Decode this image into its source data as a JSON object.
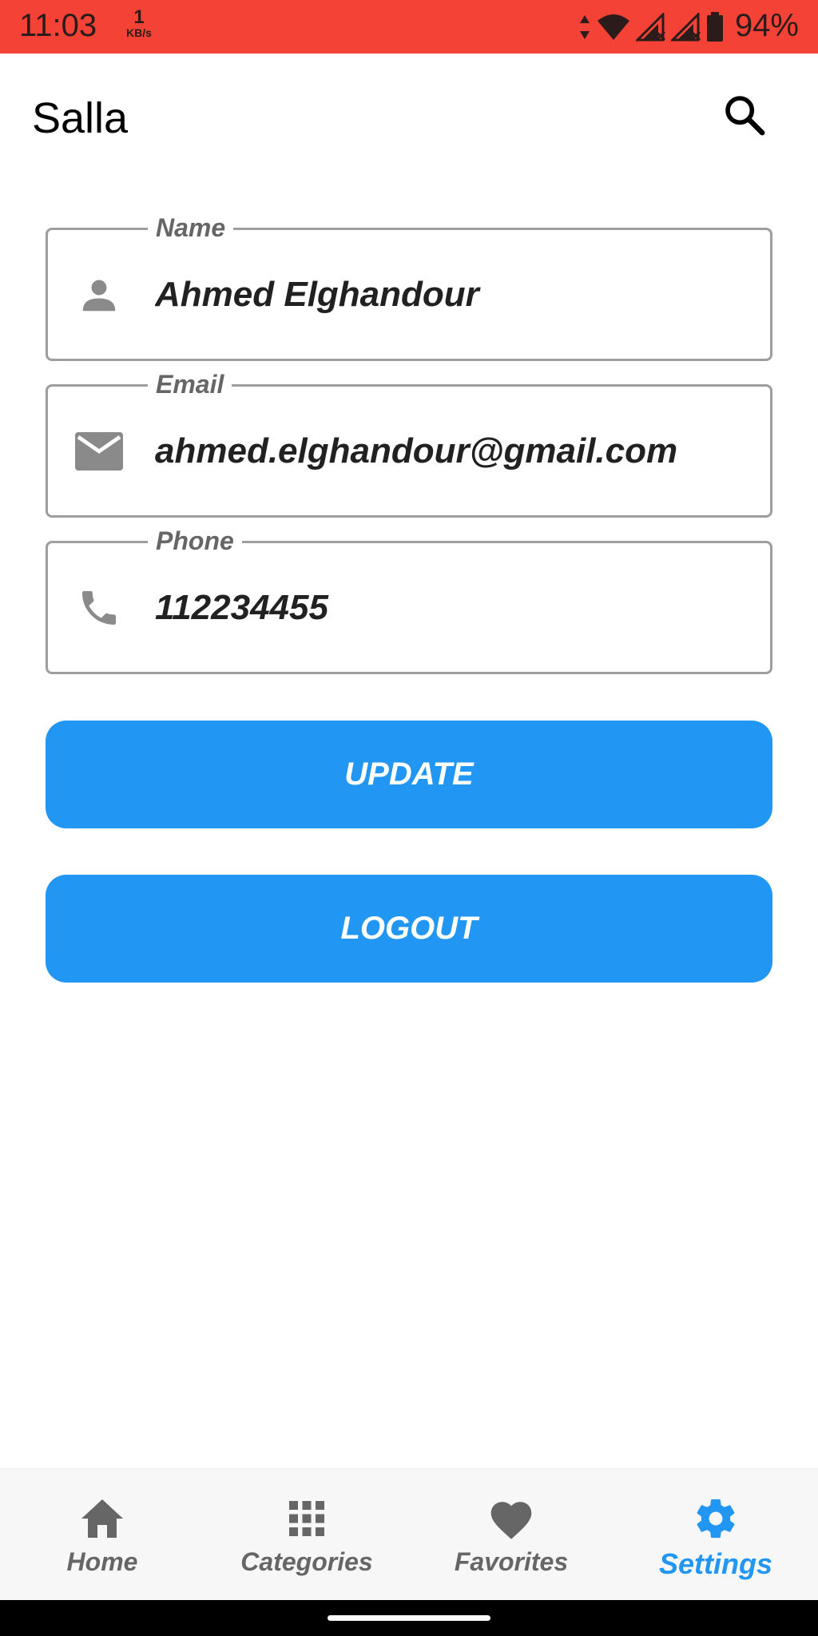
{
  "status_bar": {
    "time": "11:03",
    "net_speed_value": "1",
    "net_speed_unit": "KB/s",
    "battery_percent": "94%",
    "icons": [
      "data-transfer-icon",
      "wifi-icon",
      "signal-no-service-icon",
      "signal-no-service-icon",
      "battery-icon"
    ],
    "background_color": "#f44336"
  },
  "app_bar": {
    "title": "Salla",
    "search_icon": "search-icon"
  },
  "form": {
    "name": {
      "label": "Name",
      "value": "Ahmed Elghandour",
      "icon": "person-icon"
    },
    "email": {
      "label": "Email",
      "value": "ahmed.elghandour@gmail.com",
      "icon": "mail-icon"
    },
    "phone": {
      "label": "Phone",
      "value": "112234455",
      "icon": "phone-icon"
    }
  },
  "buttons": {
    "update_label": "UPDATE",
    "logout_label": "LOGOUT",
    "color": "#2196f3"
  },
  "bottom_nav": {
    "items": [
      {
        "label": "Home",
        "icon": "home-icon",
        "active": false
      },
      {
        "label": "Categories",
        "icon": "apps-grid-icon",
        "active": false
      },
      {
        "label": "Favorites",
        "icon": "heart-icon",
        "active": false
      },
      {
        "label": "Settings",
        "icon": "gear-icon",
        "active": true
      }
    ],
    "active_color": "#2196f3",
    "inactive_color": "#666666"
  }
}
